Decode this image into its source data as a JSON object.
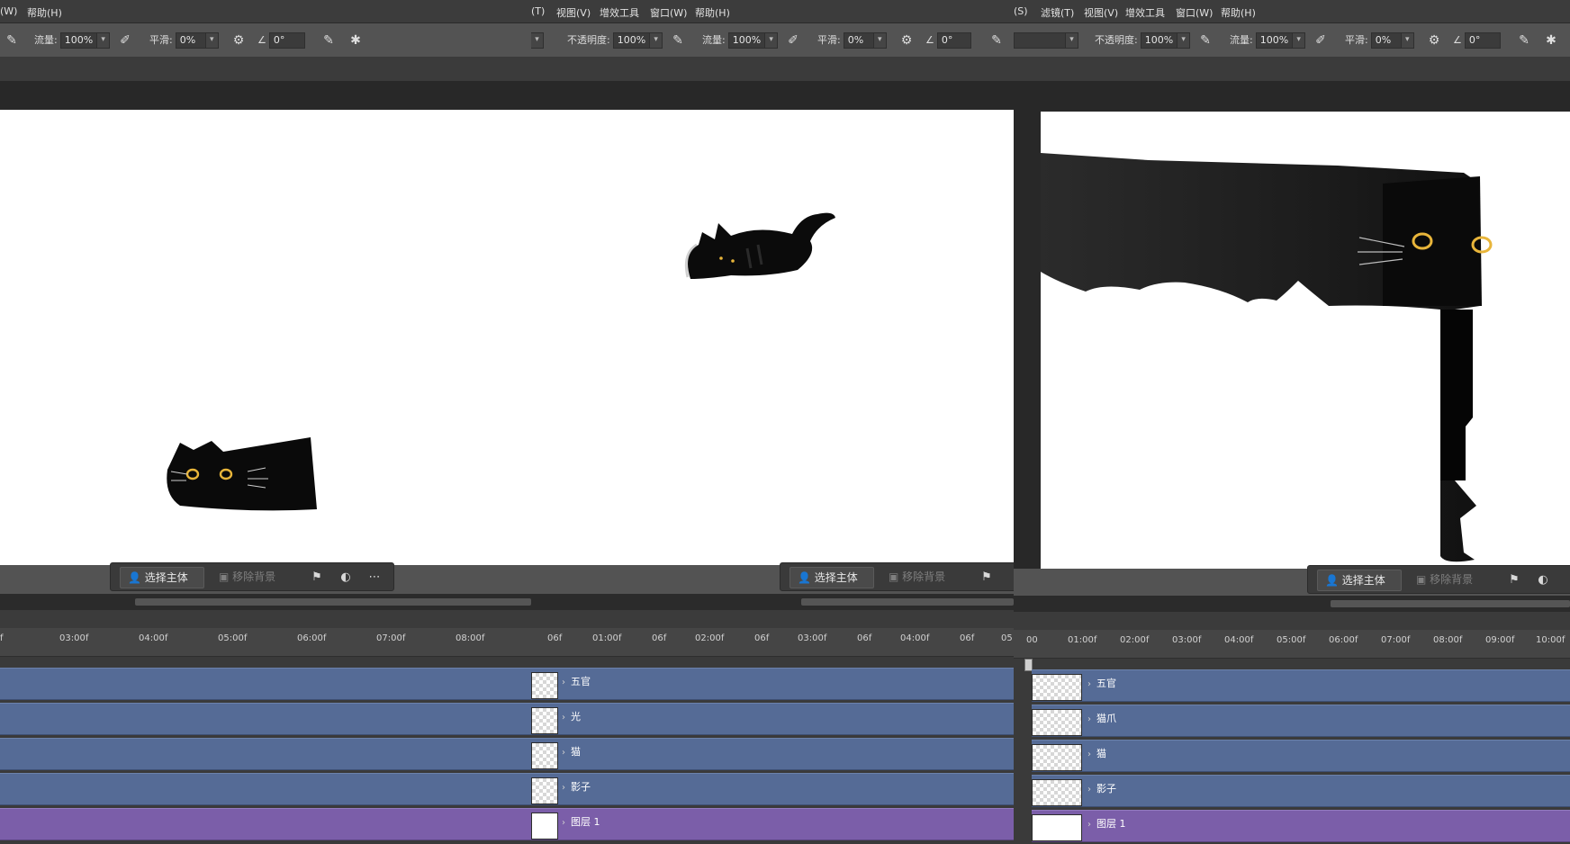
{
  "panels": [
    {
      "menu": [
        "(W)",
        "帮助(H)"
      ],
      "options": {
        "flow_label": "流量:",
        "flow_value": "100%",
        "smooth_label": "平滑:",
        "smooth_value": "0%",
        "angle_value": "0°"
      },
      "context_bar": {
        "select_subject": "选择主体",
        "remove_background": "移除背景"
      },
      "ruler_ticks": [
        "f",
        "03:00f",
        "04:00f",
        "05:00f",
        "06:00f",
        "07:00f",
        "08:00f"
      ],
      "layers": []
    },
    {
      "menu": [
        "(T)",
        "视图(V)",
        "增效工具",
        "窗口(W)",
        "帮助(H)"
      ],
      "options": {
        "opacity_label": "不透明度:",
        "opacity_value": "100%",
        "flow_label": "流量:",
        "flow_value": "100%",
        "smooth_label": "平滑:",
        "smooth_value": "0%",
        "angle_value": "0°"
      },
      "context_bar": {
        "select_subject": "选择主体",
        "remove_background": "移除背景"
      },
      "ruler_ticks": [
        "06f",
        "01:00f",
        "06f",
        "02:00f",
        "06f",
        "03:00f",
        "06f",
        "04:00f",
        "06f",
        "05"
      ],
      "layers": [
        "五官",
        "光",
        "猫",
        "影子",
        "图层 1"
      ]
    },
    {
      "menu": [
        "(S)",
        "滤镜(T)",
        "视图(V)",
        "增效工具",
        "窗口(W)",
        "帮助(H)"
      ],
      "options": {
        "opacity_label": "不透明度:",
        "opacity_value": "100%",
        "flow_label": "流量:",
        "flow_value": "100%",
        "smooth_label": "平滑:",
        "smooth_value": "0%",
        "angle_value": "0°"
      },
      "context_bar": {
        "select_subject": "选择主体",
        "remove_background": "移除背景"
      },
      "ruler_ticks": [
        "00",
        "01:00f",
        "02:00f",
        "03:00f",
        "04:00f",
        "05:00f",
        "06:00f",
        "07:00f",
        "08:00f",
        "09:00f",
        "10:00f"
      ],
      "layers": [
        "五官",
        "猫爪",
        "猫",
        "影子",
        "图层 1"
      ]
    }
  ],
  "icons": [
    "brush-icon",
    "airbrush-icon",
    "gear-icon",
    "angle-icon",
    "pressure-icon",
    "symmetry-icon",
    "person-icon",
    "image-icon",
    "pin-icon",
    "circle-half-icon",
    "more-icon"
  ],
  "colors": {
    "track_blue": "#556b96",
    "track_purple": "#7b5ea9",
    "cat_eye": "#e8b53a",
    "panel": "#535353"
  }
}
